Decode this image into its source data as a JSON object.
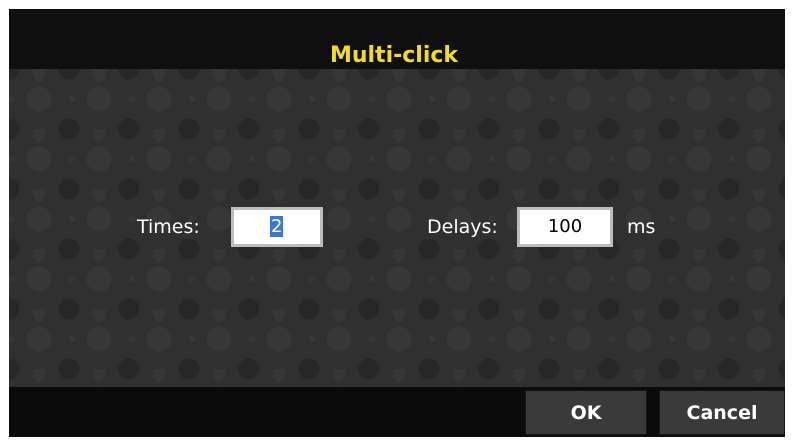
{
  "dialog": {
    "title": "Multi-click"
  },
  "fields": {
    "times_label": "Times:",
    "times_value": "2",
    "delays_label": "Delays:",
    "delays_value": "100",
    "delays_unit": "ms"
  },
  "footer": {
    "ok_label": "OK",
    "cancel_label": "Cancel"
  },
  "colors": {
    "title": "#f2dc1c",
    "background": "#2b2b2b",
    "bar": "#0f0f0f"
  }
}
